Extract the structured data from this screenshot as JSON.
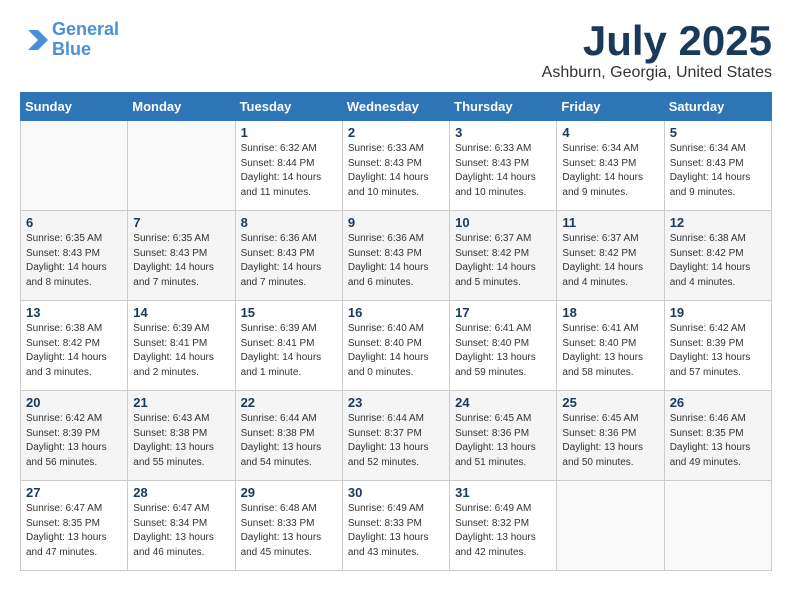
{
  "header": {
    "logo_line1": "General",
    "logo_line2": "Blue",
    "month": "July 2025",
    "location": "Ashburn, Georgia, United States"
  },
  "weekdays": [
    "Sunday",
    "Monday",
    "Tuesday",
    "Wednesday",
    "Thursday",
    "Friday",
    "Saturday"
  ],
  "weeks": [
    [
      {
        "day": "",
        "info": ""
      },
      {
        "day": "",
        "info": ""
      },
      {
        "day": "1",
        "info": "Sunrise: 6:32 AM\nSunset: 8:44 PM\nDaylight: 14 hours\nand 11 minutes."
      },
      {
        "day": "2",
        "info": "Sunrise: 6:33 AM\nSunset: 8:43 PM\nDaylight: 14 hours\nand 10 minutes."
      },
      {
        "day": "3",
        "info": "Sunrise: 6:33 AM\nSunset: 8:43 PM\nDaylight: 14 hours\nand 10 minutes."
      },
      {
        "day": "4",
        "info": "Sunrise: 6:34 AM\nSunset: 8:43 PM\nDaylight: 14 hours\nand 9 minutes."
      },
      {
        "day": "5",
        "info": "Sunrise: 6:34 AM\nSunset: 8:43 PM\nDaylight: 14 hours\nand 9 minutes."
      }
    ],
    [
      {
        "day": "6",
        "info": "Sunrise: 6:35 AM\nSunset: 8:43 PM\nDaylight: 14 hours\nand 8 minutes."
      },
      {
        "day": "7",
        "info": "Sunrise: 6:35 AM\nSunset: 8:43 PM\nDaylight: 14 hours\nand 7 minutes."
      },
      {
        "day": "8",
        "info": "Sunrise: 6:36 AM\nSunset: 8:43 PM\nDaylight: 14 hours\nand 7 minutes."
      },
      {
        "day": "9",
        "info": "Sunrise: 6:36 AM\nSunset: 8:43 PM\nDaylight: 14 hours\nand 6 minutes."
      },
      {
        "day": "10",
        "info": "Sunrise: 6:37 AM\nSunset: 8:42 PM\nDaylight: 14 hours\nand 5 minutes."
      },
      {
        "day": "11",
        "info": "Sunrise: 6:37 AM\nSunset: 8:42 PM\nDaylight: 14 hours\nand 4 minutes."
      },
      {
        "day": "12",
        "info": "Sunrise: 6:38 AM\nSunset: 8:42 PM\nDaylight: 14 hours\nand 4 minutes."
      }
    ],
    [
      {
        "day": "13",
        "info": "Sunrise: 6:38 AM\nSunset: 8:42 PM\nDaylight: 14 hours\nand 3 minutes."
      },
      {
        "day": "14",
        "info": "Sunrise: 6:39 AM\nSunset: 8:41 PM\nDaylight: 14 hours\nand 2 minutes."
      },
      {
        "day": "15",
        "info": "Sunrise: 6:39 AM\nSunset: 8:41 PM\nDaylight: 14 hours\nand 1 minute."
      },
      {
        "day": "16",
        "info": "Sunrise: 6:40 AM\nSunset: 8:40 PM\nDaylight: 14 hours\nand 0 minutes."
      },
      {
        "day": "17",
        "info": "Sunrise: 6:41 AM\nSunset: 8:40 PM\nDaylight: 13 hours\nand 59 minutes."
      },
      {
        "day": "18",
        "info": "Sunrise: 6:41 AM\nSunset: 8:40 PM\nDaylight: 13 hours\nand 58 minutes."
      },
      {
        "day": "19",
        "info": "Sunrise: 6:42 AM\nSunset: 8:39 PM\nDaylight: 13 hours\nand 57 minutes."
      }
    ],
    [
      {
        "day": "20",
        "info": "Sunrise: 6:42 AM\nSunset: 8:39 PM\nDaylight: 13 hours\nand 56 minutes."
      },
      {
        "day": "21",
        "info": "Sunrise: 6:43 AM\nSunset: 8:38 PM\nDaylight: 13 hours\nand 55 minutes."
      },
      {
        "day": "22",
        "info": "Sunrise: 6:44 AM\nSunset: 8:38 PM\nDaylight: 13 hours\nand 54 minutes."
      },
      {
        "day": "23",
        "info": "Sunrise: 6:44 AM\nSunset: 8:37 PM\nDaylight: 13 hours\nand 52 minutes."
      },
      {
        "day": "24",
        "info": "Sunrise: 6:45 AM\nSunset: 8:36 PM\nDaylight: 13 hours\nand 51 minutes."
      },
      {
        "day": "25",
        "info": "Sunrise: 6:45 AM\nSunset: 8:36 PM\nDaylight: 13 hours\nand 50 minutes."
      },
      {
        "day": "26",
        "info": "Sunrise: 6:46 AM\nSunset: 8:35 PM\nDaylight: 13 hours\nand 49 minutes."
      }
    ],
    [
      {
        "day": "27",
        "info": "Sunrise: 6:47 AM\nSunset: 8:35 PM\nDaylight: 13 hours\nand 47 minutes."
      },
      {
        "day": "28",
        "info": "Sunrise: 6:47 AM\nSunset: 8:34 PM\nDaylight: 13 hours\nand 46 minutes."
      },
      {
        "day": "29",
        "info": "Sunrise: 6:48 AM\nSunset: 8:33 PM\nDaylight: 13 hours\nand 45 minutes."
      },
      {
        "day": "30",
        "info": "Sunrise: 6:49 AM\nSunset: 8:33 PM\nDaylight: 13 hours\nand 43 minutes."
      },
      {
        "day": "31",
        "info": "Sunrise: 6:49 AM\nSunset: 8:32 PM\nDaylight: 13 hours\nand 42 minutes."
      },
      {
        "day": "",
        "info": ""
      },
      {
        "day": "",
        "info": ""
      }
    ]
  ]
}
